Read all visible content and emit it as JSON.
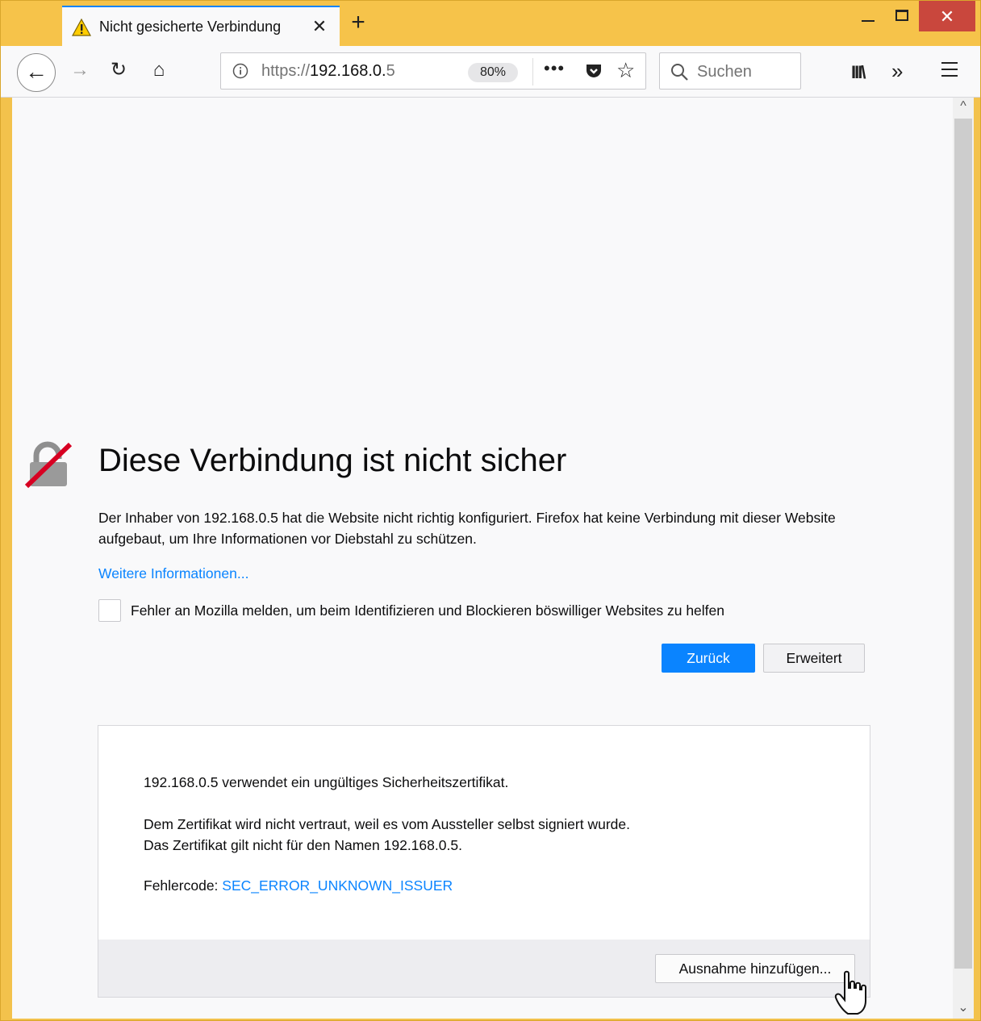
{
  "tab": {
    "title": "Nicht gesicherte Verbindung",
    "close_glyph": "✕",
    "newtab_glyph": "+"
  },
  "window": {
    "close_glyph": "✕"
  },
  "nav": {
    "back_glyph": "←",
    "forward_glyph": "→",
    "reload_glyph": "↻",
    "home_glyph": "⌂",
    "url_prefix": "https://",
    "url_host": "192.168.0.",
    "url_tail": "5",
    "zoom": "80%",
    "more_glyph": "•••",
    "star_glyph": "☆",
    "search_placeholder": "Suchen",
    "library_glyph": "III\\",
    "overflow_glyph": "»"
  },
  "page": {
    "heading": "Diese Verbindung ist nicht sicher",
    "description": "Der Inhaber von 192.168.0.5 hat die Website nicht richtig konfiguriert. Firefox hat keine Verbindung mit dieser Website aufgebaut, um Ihre Informationen vor Diebstahl zu schützen.",
    "more_info": "Weitere Informationen...",
    "report_label": "Fehler an Mozilla melden, um beim Identifizieren und Blockieren böswilliger Websites zu helfen",
    "back_button": "Zurück",
    "advanced_button": "Erweitert"
  },
  "advanced": {
    "line1": "192.168.0.5 verwendet ein ungültiges Sicherheitszertifikat.",
    "line2": "Dem Zertifikat wird nicht vertraut, weil es vom Aussteller selbst signiert wurde.",
    "line3": "Das Zertifikat gilt nicht für den Namen 192.168.0.5.",
    "error_label": "Fehlercode: ",
    "error_code": "SEC_ERROR_UNKNOWN_ISSUER",
    "exception_button": "Ausnahme hinzufügen..."
  },
  "scrollbar": {
    "up_glyph": "^",
    "down_glyph": "⌄"
  },
  "colors": {
    "accent": "#0a84ff",
    "titlebar": "#f6c34a",
    "close": "#c9473d",
    "lock_slash": "#d70022"
  },
  "icons": [
    "warning-icon",
    "back-arrow-icon",
    "forward-arrow-icon",
    "reload-icon",
    "home-icon",
    "info-icon",
    "pocket-icon",
    "bookmark-star-icon",
    "search-icon",
    "library-icon",
    "overflow-icon",
    "hamburger-menu-icon",
    "broken-lock-icon",
    "hand-cursor-icon"
  ]
}
